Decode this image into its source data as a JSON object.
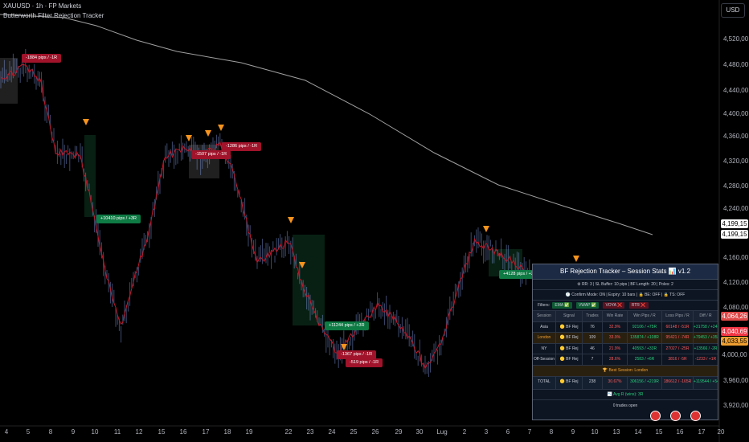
{
  "header": {
    "title": "XAUUSD · 1h · FP Markets",
    "indicator": "Butterworth Filter Rejection Tracker"
  },
  "currency_button": "USD",
  "y_axis": {
    "ticks": [
      "4,520,00",
      "4,480,00",
      "4,440,00",
      "4,400,00",
      "4,360,00",
      "4,320,00",
      "4,280,00",
      "4,240,00",
      "4,160,00",
      "4,120,00",
      "4,080,00",
      "3,960,00",
      "3,920,00"
    ]
  },
  "price_tags": {
    "tag1": {
      "text": "4,199,15",
      "bg": "#ffffff",
      "fg": "#000000"
    },
    "tag2": {
      "text": "4,199,15",
      "bg": "#ffffff",
      "fg": "#000000"
    },
    "tag3": {
      "text": "4,064,26",
      "bg": "#e04848",
      "fg": "#ffffff"
    },
    "tag4": {
      "text": "4,040,69",
      "bg": "#f23645",
      "fg": "#ffffff"
    },
    "tag5": {
      "text": "4,033,55",
      "bg": "#f0a030",
      "fg": "#000000"
    },
    "tag6": {
      "text": "4,000,00",
      "bg": "#000000",
      "fg": "#b2b5be"
    }
  },
  "x_axis": {
    "labels": [
      "4",
      "5",
      "8",
      "9",
      "10",
      "11",
      "12",
      "15",
      "16",
      "17",
      "18",
      "19",
      "22",
      "23",
      "24",
      "25",
      "26",
      "29",
      "30",
      "Lug",
      "2",
      "3",
      "6",
      "7",
      "8",
      "9",
      "10",
      "13",
      "14",
      "15",
      "16",
      "17",
      "20"
    ]
  },
  "bubbles": [
    {
      "text": "-1884 pips / -1R",
      "type": "loss"
    },
    {
      "text": "+10410 pips / +3R",
      "type": "win"
    },
    {
      "text": "-1507 pips / -1R",
      "type": "loss"
    },
    {
      "text": "-1286 pips / -1R",
      "type": "loss"
    },
    {
      "text": "+11244 pips / +3R",
      "type": "win"
    },
    {
      "text": "-1367 pips / -1R",
      "type": "loss"
    },
    {
      "text": "-519 pips / -1R",
      "type": "loss"
    },
    {
      "text": "+4128 pips / +3R",
      "type": "win"
    }
  ],
  "colors": {
    "win": "#0e7a44",
    "loss": "#a0132a",
    "arrow": "#f7941d",
    "ma_slow": "#c8c8c8",
    "ma_fast": "#c0182a",
    "candle": "#7088c8"
  },
  "panel": {
    "title": "BF Rejection Tracker – Session Stats 📊 v1.2",
    "info1": "⚙ RR: 3  |  SL Buffer: 10 pips  |  BF Length: 20  |  Poles: 2",
    "info2": "🕐 Confirm Mode: ON  |  Expiry: 10 bars  |  🔒 BE: OFF  |  🔒 TS: OFF",
    "filters_label": "Filters:",
    "filters": [
      {
        "label": "EMA",
        "state": "✅"
      },
      {
        "label": "VWAP",
        "state": "✅"
      },
      {
        "label": "VOYA",
        "state": "❌"
      },
      {
        "label": "RTR",
        "state": "❌"
      }
    ],
    "headers": [
      "Session",
      "Signal",
      "Trades",
      "Win Rate",
      "Win Pips / R",
      "Loss Pips / R",
      "Diff / R"
    ],
    "rows": [
      [
        "Asia",
        "🟡 BF Rej",
        "76",
        "32.9%",
        "92106 / +75R",
        "60148 / -51R",
        "+31758 / +24R"
      ],
      [
        "London",
        "🟡 BF Rej",
        "109",
        "33.9%",
        "135874 / +108R",
        "95421 / -74R",
        "+79453 / +35R"
      ],
      [
        "NY",
        "🟡 BF Rej",
        "46",
        "21.9%",
        "40593 / +33R",
        "27027 / -25R",
        "+13566 / -2R"
      ],
      [
        "Off-Session",
        "🟡 BF Rej",
        "7",
        "28.6%",
        "2583 / +6R",
        "3816 / -5R",
        "-1233 / +1R"
      ]
    ],
    "best_session": "🏆 Best Session: London",
    "total": [
      "TOTAL",
      "🟡 BF Rej",
      "238",
      "30.67%",
      "306156 / +219R",
      "186612 / -165R",
      "+119544 / +54R"
    ],
    "avg_r": "📉 Avg R (wins): 3R",
    "open_trades": "0 trades open"
  }
}
